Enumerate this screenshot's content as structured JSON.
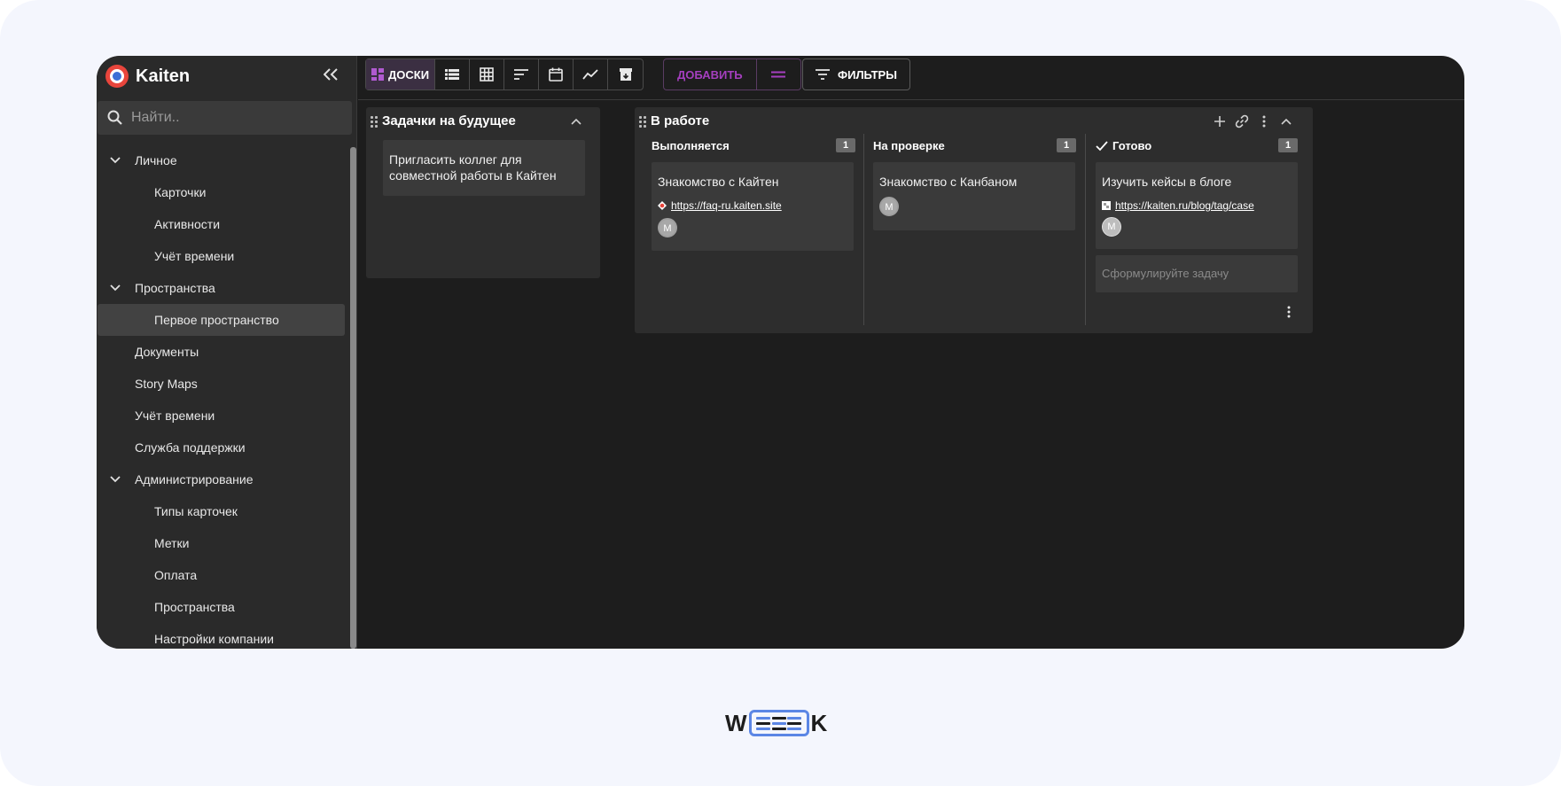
{
  "app": {
    "name": "Kaiten"
  },
  "search": {
    "placeholder": "Найти.."
  },
  "sidebar": {
    "items": [
      {
        "label": "Личное"
      },
      {
        "label": "Карточки"
      },
      {
        "label": "Активности"
      },
      {
        "label": "Учёт времени"
      },
      {
        "label": "Пространства"
      },
      {
        "label": "Первое пространство"
      },
      {
        "label": "Документы"
      },
      {
        "label": "Story Maps"
      },
      {
        "label": "Учёт времени"
      },
      {
        "label": "Служба поддержки"
      },
      {
        "label": "Администрирование"
      },
      {
        "label": "Типы карточек"
      },
      {
        "label": "Метки"
      },
      {
        "label": "Оплата"
      },
      {
        "label": "Пространства"
      },
      {
        "label": "Настройки компании"
      }
    ]
  },
  "toolbar": {
    "boards_label": "ДОСКИ",
    "add_label": "ДОБАВИТЬ",
    "filters_label": "ФИЛЬТРЫ"
  },
  "boards": [
    {
      "title": "Задачки на будущее",
      "cards": [
        {
          "title": "Пригласить коллег для совместной работы в Кайтен"
        }
      ]
    },
    {
      "title": "В работе",
      "columns": [
        {
          "title": "Выполняется",
          "count": "1",
          "cards": [
            {
              "title": "Знакомство с Кайтен",
              "link": "https://faq-ru.kaiten.site",
              "avatar": "M"
            }
          ]
        },
        {
          "title": "На проверке",
          "count": "1",
          "cards": [
            {
              "title": "Знакомство с Канбаном",
              "avatar": "M"
            }
          ]
        },
        {
          "title": "Готово",
          "count": "1",
          "cards": [
            {
              "title": "Изучить кейсы в блоге",
              "link": "https://kaiten.ru/blog/tag/case",
              "avatar": "M"
            }
          ],
          "new_task_placeholder": "Сформулируйте задачу"
        }
      ]
    }
  ],
  "footer_logo": {
    "text_left": "W",
    "text_right": "K"
  },
  "colors": {
    "accent": "#a53fbf",
    "logo_blue": "#5b86e5",
    "app_bg": "#1d1d1d"
  }
}
